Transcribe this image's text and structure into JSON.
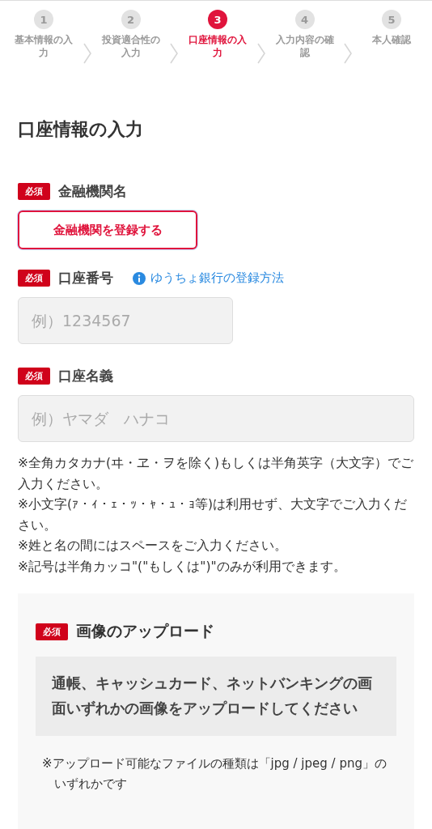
{
  "steps": [
    {
      "number": "1",
      "label": "基本情報の入力",
      "selected": false
    },
    {
      "number": "2",
      "label": "投資適合性の入力",
      "selected": false
    },
    {
      "number": "3",
      "label": "口座情報の入力",
      "selected": true
    },
    {
      "number": "4",
      "label": "入力内容の確認",
      "selected": false
    },
    {
      "number": "5",
      "label": "本人確認",
      "selected": false
    }
  ],
  "page_title": "口座情報の入力",
  "fields": [
    {
      "kind": "button",
      "badge": "必須",
      "label": "金融機関名",
      "button": "金融機関を登録する"
    },
    {
      "kind": "short_input",
      "badge": "必須",
      "label": "口座番号",
      "link": "ゆうちょ銀行の登録方法",
      "placeholder": "例）1234567"
    },
    {
      "kind": "wide_input",
      "badge": "必須",
      "label": "口座名義",
      "placeholder": "例）ヤマダ　ハナコ"
    }
  ],
  "notes": [
    "※全角カタカナ(ヰ・ヱ・ヲを除く)もしくは半角英字（大文字）でご入力ください。",
    "※小文字(ｧ・ｨ・ｪ・ｯ・ｬ・ｭ・ｮ等)は利用せず、大文字でご入力ください。",
    "※姓と名の間にはスペースをご入力ください。",
    "※記号は半角カッコ\"(\"もしくは\")\"のみが利用できます。"
  ],
  "upload": {
    "badge": "必須",
    "title": "画像のアップロード",
    "instruction": "通帳、キャッシュカード、ネットバンキングの画面いずれかの画像をアップロードしてください",
    "notes": [
      "※アップロード可能なファイルの種類は「jpg / jpeg / png」のいずれかです"
    ]
  }
}
